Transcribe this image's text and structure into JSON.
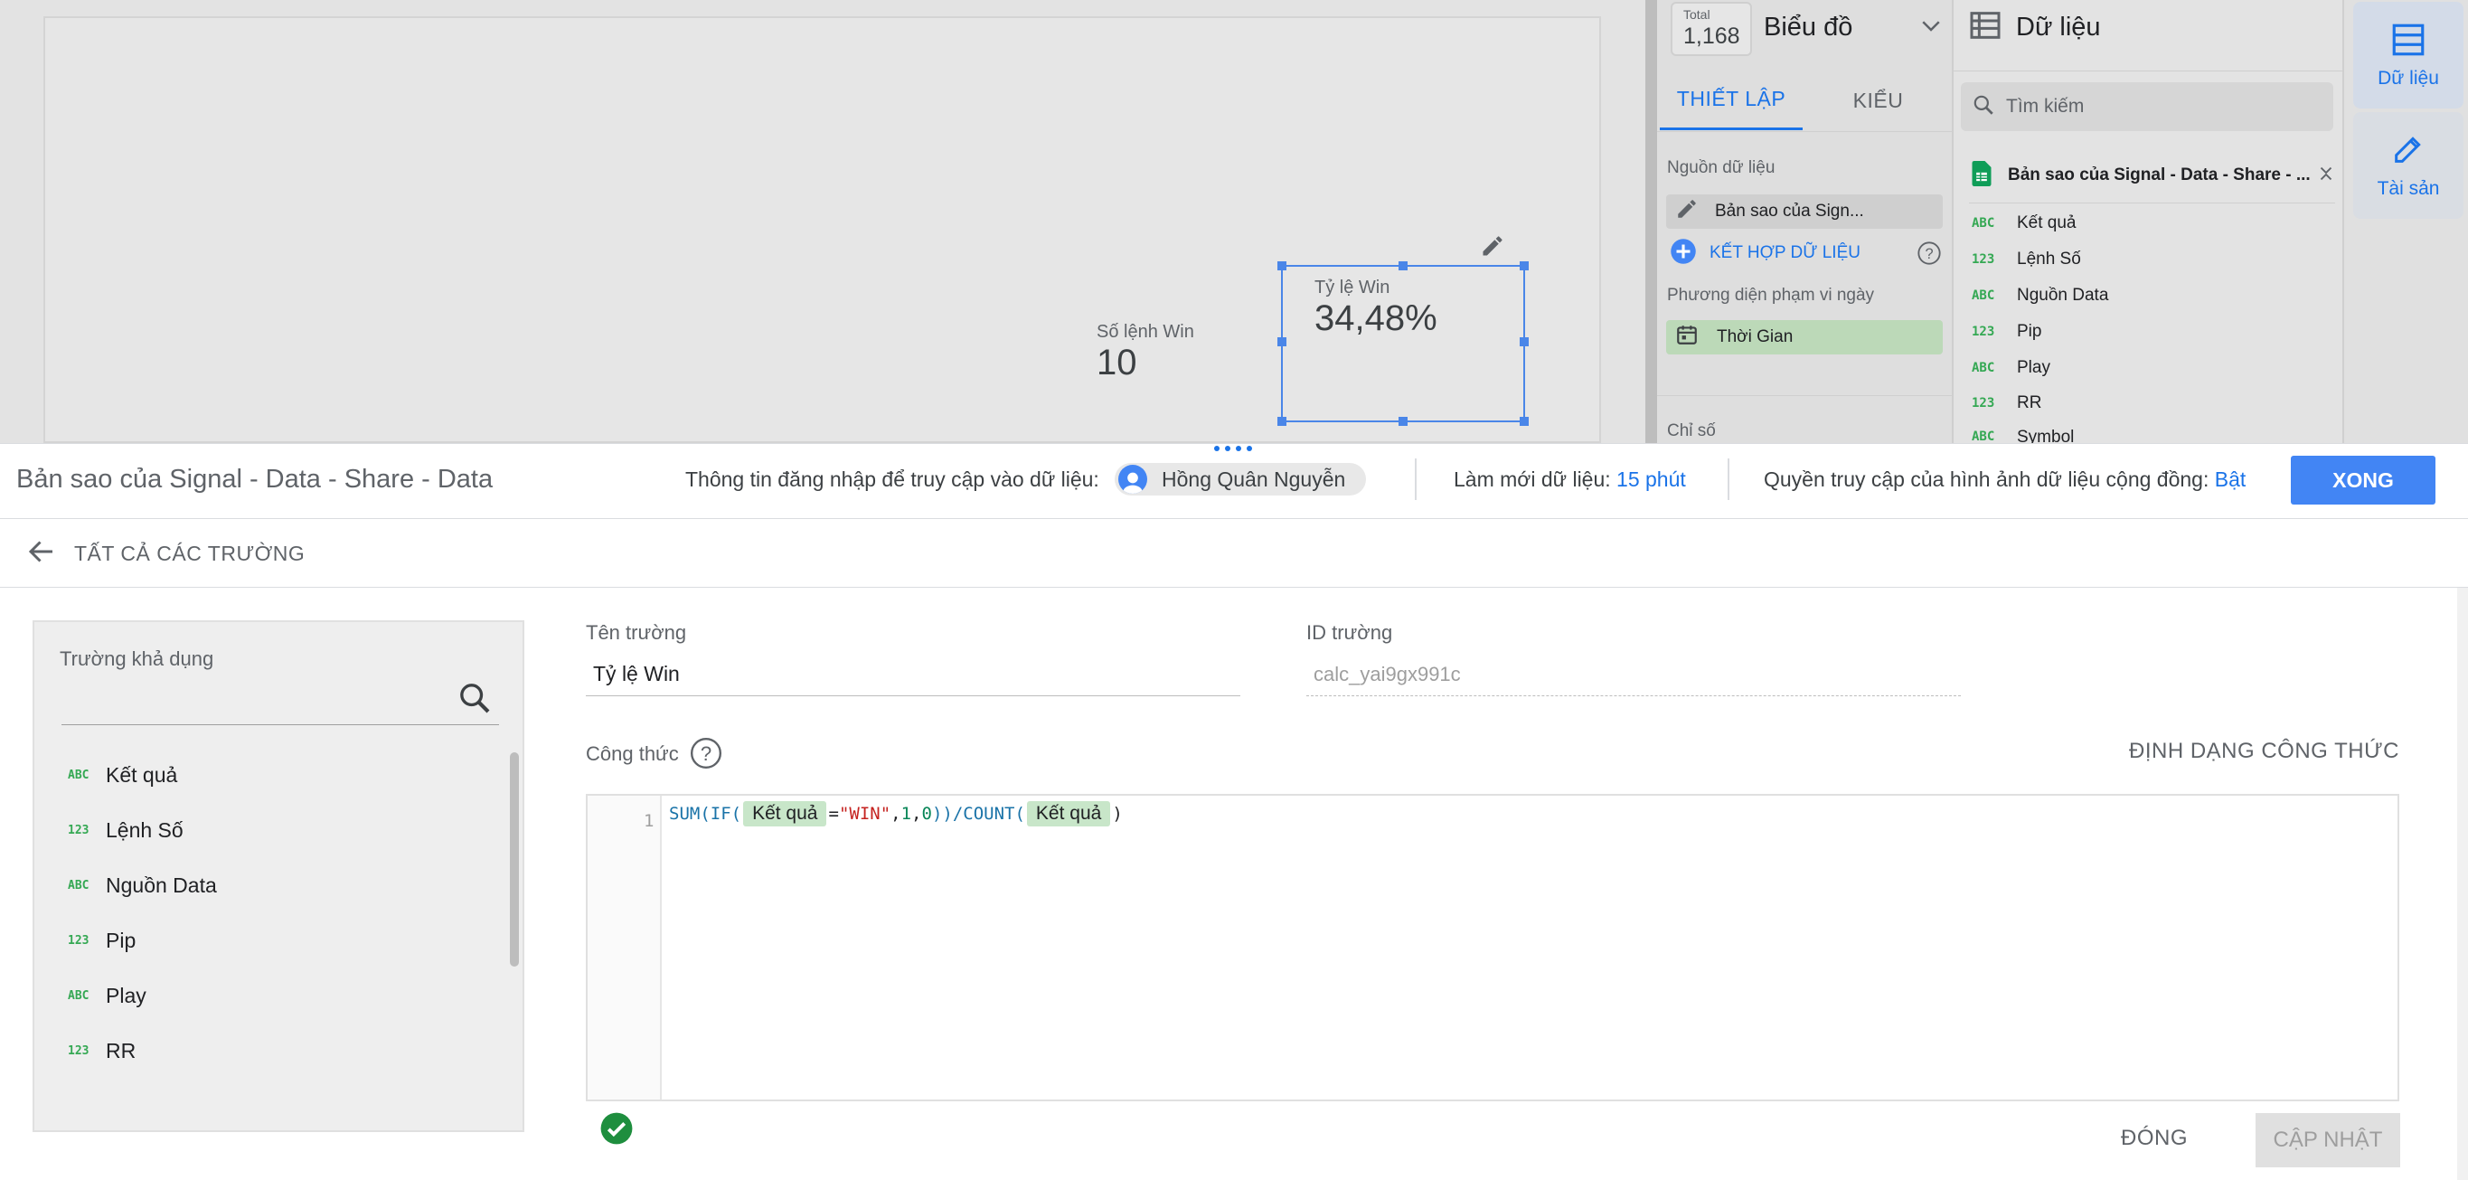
{
  "canvas": {
    "scorecard_wins": {
      "label": "Số lệnh Win",
      "value": "10"
    },
    "scorecard_rate": {
      "label": "Tỷ lệ Win",
      "value": "34,48%"
    }
  },
  "properties": {
    "total_label": "Total",
    "total_value": "1,168",
    "chart_type": "Biểu đồ",
    "tab_setup": "THIẾT LẬP",
    "tab_style": "KIỂU",
    "data_source_title": "Nguồn dữ liệu",
    "data_source_chip": "Bản sao của Sign...",
    "blend_label": "KẾT HỢP DỮ LIỆU",
    "date_range_title": "Phương diện phạm vi ngày",
    "date_chip": "Thời Gian",
    "metrics_title": "Chỉ số"
  },
  "data_panel": {
    "title": "Dữ liệu",
    "search_placeholder": "Tìm kiếm",
    "source_name": "Bản sao của Signal - Data - Share - ...",
    "fields": [
      {
        "type": "ABC",
        "name": "Kết quả"
      },
      {
        "type": "123",
        "name": "Lệnh Số"
      },
      {
        "type": "ABC",
        "name": "Nguồn Data"
      },
      {
        "type": "123",
        "name": "Pip"
      },
      {
        "type": "ABC",
        "name": "Play"
      },
      {
        "type": "123",
        "name": "RR"
      },
      {
        "type": "ABC",
        "name": "Symbol"
      }
    ]
  },
  "rail": {
    "data_label": "Dữ liệu",
    "assets_label": "Tài sản"
  },
  "editor": {
    "source_title": "Bản sao của Signal - Data - Share - Data",
    "credentials_label": "Thông tin đăng nhập để truy cập vào dữ liệu:",
    "user_name": "Hồng Quân Nguyễn",
    "refresh_label": "Làm mới dữ liệu:",
    "refresh_value": "15 phút",
    "community_label": "Quyền truy cập của hình ảnh dữ liệu cộng đồng:",
    "community_value": "Bật",
    "done_label": "XONG",
    "back_label": "TẤT CẢ CÁC TRƯỜNG",
    "available_fields_label": "Trường khả dụng",
    "available_fields": [
      {
        "type": "ABC",
        "name": "Kết quả"
      },
      {
        "type": "123",
        "name": "Lệnh Số"
      },
      {
        "type": "ABC",
        "name": "Nguồn Data"
      },
      {
        "type": "123",
        "name": "Pip"
      },
      {
        "type": "ABC",
        "name": "Play"
      },
      {
        "type": "123",
        "name": "RR"
      }
    ],
    "field_name_label": "Tên trường",
    "field_name_value": "Tỷ lệ Win",
    "field_id_label": "ID trường",
    "field_id_value": "calc_yai9gx991c",
    "formula_label": "Công thức",
    "format_formula_label": "ĐỊNH DẠNG CÔNG THỨC",
    "line_number": "1",
    "formula": {
      "p1": "SUM(IF(",
      "pill1": "Kết quả",
      "p2": "=",
      "str": "\"WIN\"",
      "p3": ",",
      "n1": "1",
      "p4": ",",
      "n2": "0",
      "p5": "))/COUNT(",
      "pill2": "Kết quả",
      "p6": ")"
    },
    "close_label": "ĐÓNG",
    "update_label": "CẬP NHẬT"
  },
  "colors": {
    "accent": "#1a73e8",
    "done_button": "#4285f4",
    "valid": "#1e8e3e",
    "field_pill": "#c8e6c9",
    "selection": "#4a86e8"
  }
}
